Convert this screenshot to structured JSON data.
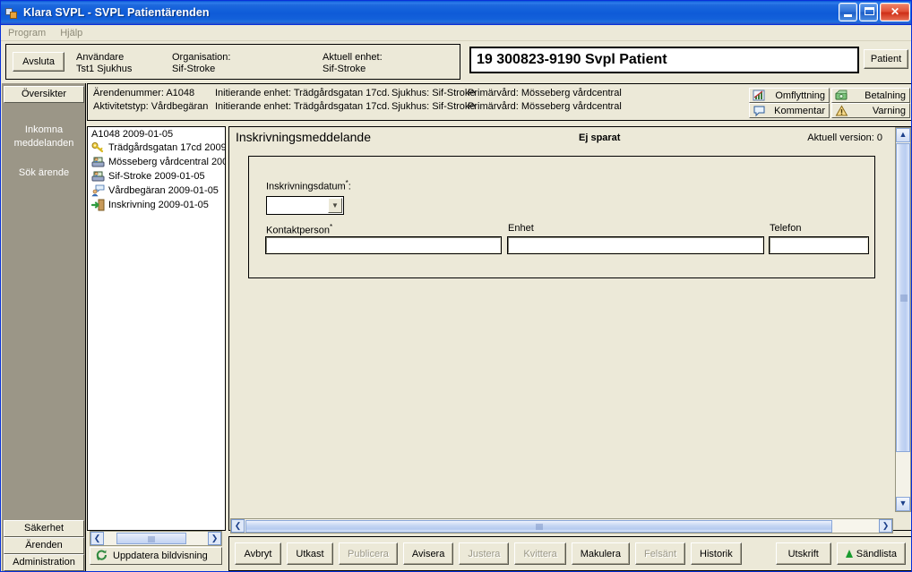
{
  "window": {
    "title": "Klara SVPL - SVPL Patientärenden",
    "icon": "app-icon",
    "minimize_label": "Minimera",
    "maximize_label": "Maximera",
    "close_label": "Stäng"
  },
  "menubar": {
    "items": [
      {
        "label": "Program",
        "name": "menu-program"
      },
      {
        "label": "Hjälp",
        "name": "menu-hjalp"
      }
    ]
  },
  "topbar": {
    "exit_button": "Avsluta",
    "columns": [
      {
        "title": "Användare",
        "value": "Tst1 Sjukhus"
      },
      {
        "title": "Organisation:",
        "value": "Sif-Stroke"
      },
      {
        "title": "Aktuell enhet:",
        "value": "Sif-Stroke"
      }
    ],
    "patient_field_value": "19 300823-9190 Svpl Patient",
    "patient_button": "Patient"
  },
  "sidebar": {
    "active_tab": "Översikter",
    "links": [
      {
        "label": "Inkomna",
        "name": "sidebar-item-inkomna-1"
      },
      {
        "label": "meddelanden",
        "name": "sidebar-item-inkomna-2"
      },
      {
        "label": "Sök ärende",
        "name": "sidebar-item-sok-arende"
      }
    ],
    "bottom_items": [
      {
        "label": "Säkerhet",
        "name": "sidebar-item-sakerhet"
      },
      {
        "label": "Ärenden",
        "name": "sidebar-item-arenden"
      },
      {
        "label": "Administration",
        "name": "sidebar-item-administration"
      }
    ]
  },
  "case_header": {
    "row1": {
      "case_number": "Ärendenummer: A1048",
      "initiating_unit": "Initierande enhet: Trädgårdsgatan 17cd.",
      "hospital": "Sjukhus: Sif-Stroke",
      "primary_care": "Primärvård: Mösseberg vårdcentral"
    },
    "row2": {
      "activity_type": "Aktivitetstyp: Vårdbegäran",
      "initiating_unit": "Initierande enhet: Trädgårdsgatan 17cd.",
      "hospital": "Sjukhus: Sif-Stroke",
      "primary_care": "Primärvård: Mösseberg vårdcentral"
    },
    "buttons": [
      {
        "label": "Omflyttning",
        "icon": "relocation-icon",
        "name": "omflyttning-button"
      },
      {
        "label": "Betalning",
        "icon": "payment-icon",
        "name": "betalning-button"
      },
      {
        "label": "Kommentar",
        "icon": "comment-icon",
        "name": "kommentar-button"
      },
      {
        "label": "Varning",
        "icon": "warning-icon",
        "name": "varning-button"
      }
    ]
  },
  "tree": {
    "root": "A1048 2009-01-05",
    "items": [
      {
        "label": "Trädgårdsgatan 17cd 2009",
        "icon": "key-icon"
      },
      {
        "label": "Mösseberg vårdcentral 200",
        "icon": "user-computer-icon"
      },
      {
        "label": "Sif-Stroke 2009-01-05",
        "icon": "user-computer-icon"
      },
      {
        "label": "Vårdbegäran 2009-01-05",
        "icon": "user-comment-icon"
      },
      {
        "label": "Inskrivning 2009-01-05",
        "icon": "admit-door-icon"
      }
    ],
    "refresh_label": "Uppdatera bildvisning",
    "refresh_icon": "refresh-icon",
    "scroll_left_icon": "chevron-left-icon",
    "scroll_right_icon": "chevron-right-icon"
  },
  "form": {
    "title": "Inskrivningsmeddelande",
    "status": "Ej sparat",
    "version": "Aktuell version: 0",
    "fields": [
      {
        "label": "Inskrivningsdatum",
        "required": "*",
        "suffix": ":",
        "value": "",
        "name": "inskrivningsdatum-combobox"
      },
      {
        "label": "Kontaktperson",
        "required": "*",
        "suffix": "",
        "value": "",
        "name": "kontaktperson-input"
      },
      {
        "label": "Enhet",
        "required": "",
        "suffix": "",
        "value": "",
        "name": "enhet-input"
      },
      {
        "label": "Telefon",
        "required": "",
        "suffix": "",
        "value": "",
        "name": "telefon-input"
      }
    ]
  },
  "actionbar": {
    "buttons": [
      {
        "label": "Avbryt",
        "enabled": true,
        "name": "avbryt-button"
      },
      {
        "label": "Utkast",
        "enabled": true,
        "name": "utkast-button"
      },
      {
        "label": "Publicera",
        "enabled": false,
        "name": "publicera-button"
      },
      {
        "label": "Avisera",
        "enabled": true,
        "name": "avisera-button"
      },
      {
        "label": "Justera",
        "enabled": false,
        "name": "justera-button"
      },
      {
        "label": "Kvittera",
        "enabled": false,
        "name": "kvittera-button"
      },
      {
        "label": "Makulera",
        "enabled": true,
        "name": "makulera-button"
      },
      {
        "label": "Felsänt",
        "enabled": false,
        "name": "felsant-button"
      },
      {
        "label": "Historik",
        "enabled": true,
        "name": "historik-button"
      }
    ],
    "print_button": "Utskrift",
    "sendlist_button": "Sändlista",
    "sendlist_icon": "green-up-arrow-icon"
  },
  "colors": {
    "window_bg": "#ece9d8",
    "titlebar_blue": "#1260da",
    "sidebar_grey": "#9b9687",
    "field_white": "#ffffff",
    "scrollbar_blue": "#c4d5f3",
    "green_accent": "#1a9b2e",
    "disabled_text": "#9b9887"
  }
}
